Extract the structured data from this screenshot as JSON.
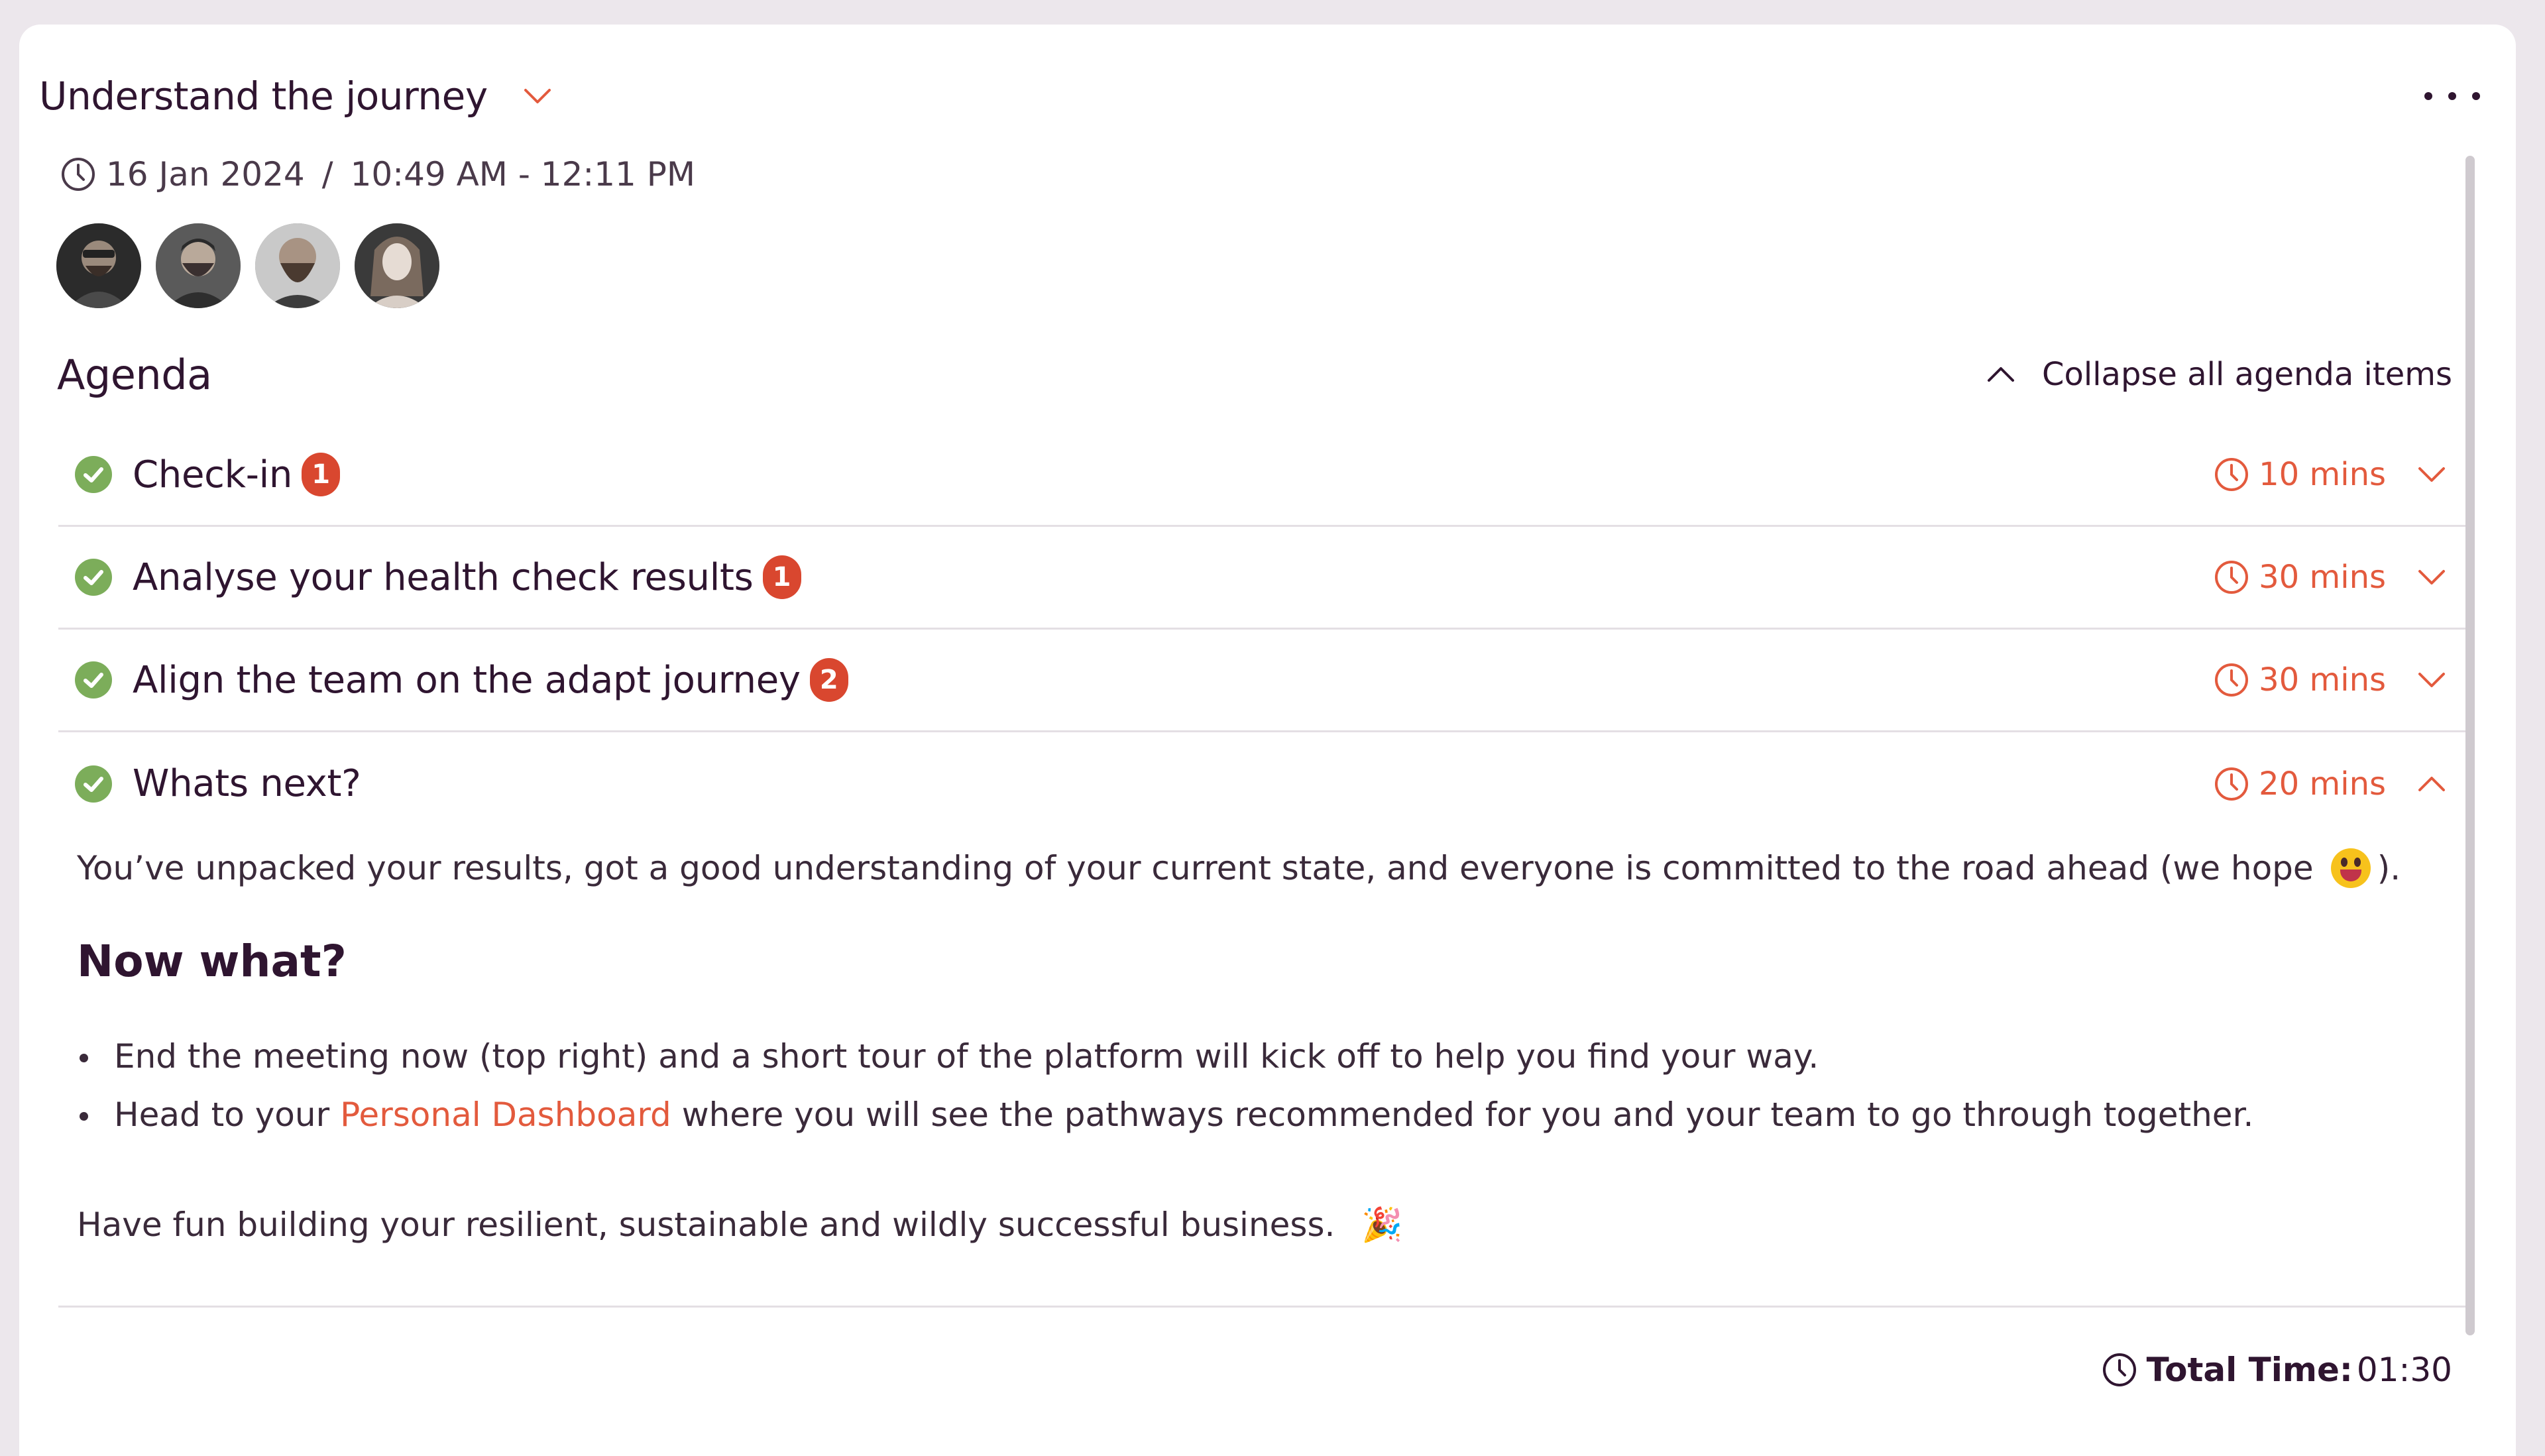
{
  "meeting": {
    "title": "Understand the journey",
    "date": "16 Jan 2024",
    "separator": "/",
    "time_range": "10:49 AM - 12:11 PM",
    "attendees": [
      "attendee-1",
      "attendee-2",
      "attendee-3",
      "attendee-4"
    ]
  },
  "agenda": {
    "title": "Agenda",
    "collapse_label": "Collapse all agenda items",
    "items": [
      {
        "label": "Check-in",
        "badge": "1",
        "duration": "10 mins",
        "open": false
      },
      {
        "label": "Analyse your health check results",
        "badge": "1",
        "duration": "30 mins",
        "open": false
      },
      {
        "label": "Align the team on the adapt journey",
        "badge": "2",
        "duration": "30 mins",
        "open": false
      },
      {
        "label": "Whats next?",
        "badge": "",
        "duration": "20 mins",
        "open": true
      }
    ]
  },
  "details": {
    "intro": "You’ve unpacked your results, got a good understanding of your current state, and everyone is committed to the road ahead (we hope",
    "intro_end": ").",
    "subheading": "Now what?",
    "bullet1": "End the meeting now (top right) and a short tour of the platform will kick off to help you find your way.",
    "bullet2_pre": "Head to your",
    "bullet2_link": "Personal Dashboard",
    "bullet2_post": "where you will see the pathways recommended for you and your team to go through together.",
    "outro": "Have fun building your resilient, sustainable and wildly successful business.",
    "outro_emoji": "🎉"
  },
  "footer": {
    "total_label": "Total Time:",
    "total_value": "01:30"
  },
  "colors": {
    "accent": "#e35a3d",
    "badge": "#d9472f",
    "check": "#7cad5a",
    "text": "#2f1530"
  },
  "icons": {
    "clock": "clock-icon",
    "check": "check-circle-icon",
    "chevron_down": "chevron-down-icon",
    "chevron_up": "chevron-up-icon",
    "more": "more-horizontal-icon"
  }
}
